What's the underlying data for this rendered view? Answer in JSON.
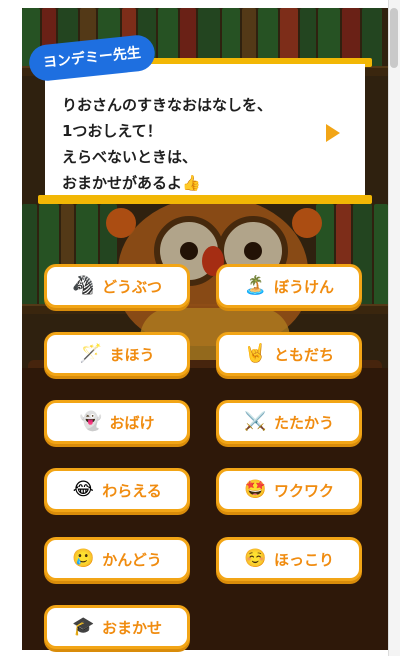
{
  "header": {
    "speaker_name": "ヨンデミー先生",
    "message_lines": [
      "りおさんのすきなおはなしを、",
      "1つおしえて！",
      "えらべないときは、",
      "おまかせがあるよ👍"
    ]
  },
  "genres": [
    {
      "label": "どうぶつ",
      "icon": "zebra-icon",
      "glyph": "🦓"
    },
    {
      "label": "ぼうけん",
      "icon": "island-icon",
      "glyph": "🏝️"
    },
    {
      "label": "まほう",
      "icon": "magic-wand-icon",
      "glyph": "🪄"
    },
    {
      "label": "ともだち",
      "icon": "hand-sign-icon",
      "glyph": "🤘"
    },
    {
      "label": "おばけ",
      "icon": "ghost-icon",
      "glyph": "👻"
    },
    {
      "label": "たたかう",
      "icon": "crossed-swords-icon",
      "glyph": "⚔️"
    },
    {
      "label": "わらえる",
      "icon": "laughing-face-icon",
      "glyph": "😂"
    },
    {
      "label": "ワクワク",
      "icon": "star-struck-face-icon",
      "glyph": "🤩"
    },
    {
      "label": "かんどう",
      "icon": "tearful-face-icon",
      "glyph": "🥲"
    },
    {
      "label": "ほっこり",
      "icon": "smiling-face-icon",
      "glyph": "☺️"
    },
    {
      "label": "おまかせ",
      "icon": "graduation-cap-icon",
      "glyph": "🎓"
    }
  ],
  "colors": {
    "accent": "#f2a516",
    "label": "#f08c10",
    "name_tag": "#1e6fe0",
    "tape": "#f2b705"
  }
}
